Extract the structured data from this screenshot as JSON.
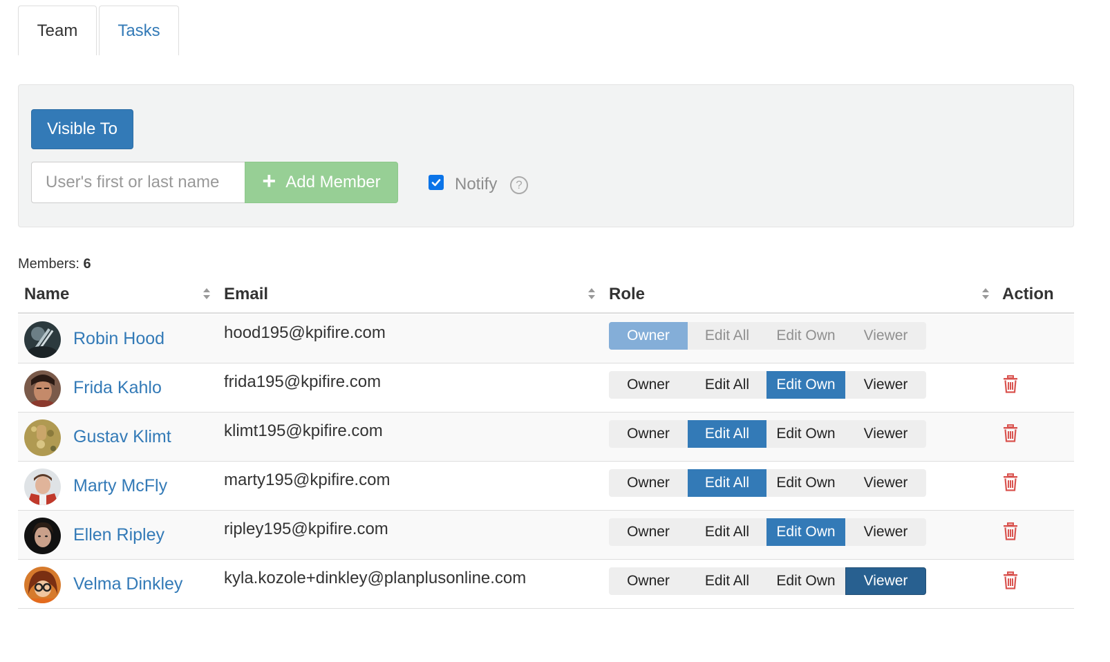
{
  "tabs": [
    {
      "label": "Team",
      "active": true
    },
    {
      "label": "Tasks",
      "active": false
    }
  ],
  "panel": {
    "visible_to_label": "Visible To",
    "search_placeholder": "User's first or last name",
    "add_member_label": "Add Member",
    "add_icon": "plus-icon",
    "notify_label": "Notify",
    "notify_checked": true,
    "help_icon": "question-circle-icon"
  },
  "members": {
    "label": "Members:",
    "count": "6"
  },
  "table": {
    "headers": {
      "name": "Name",
      "email": "Email",
      "role": "Role",
      "action": "Action"
    },
    "role_options": [
      "Owner",
      "Edit All",
      "Edit Own",
      "Viewer"
    ],
    "rows": [
      {
        "name": "Robin Hood",
        "email": "hood195@kpifire.com",
        "role": "Owner",
        "deletable": false
      },
      {
        "name": "Frida Kahlo",
        "email": "frida195@kpifire.com",
        "role": "Edit Own",
        "deletable": true
      },
      {
        "name": "Gustav Klimt",
        "email": "klimt195@kpifire.com",
        "role": "Edit All",
        "deletable": true
      },
      {
        "name": "Marty McFly",
        "email": "marty195@kpifire.com",
        "role": "Edit All",
        "deletable": true
      },
      {
        "name": "Ellen Ripley",
        "email": "ripley195@kpifire.com",
        "role": "Edit Own",
        "deletable": true
      },
      {
        "name": "Velma Dinkley",
        "email": "kyla.kozole+dinkley@planplusonline.com",
        "role": "Viewer",
        "deletable": true
      }
    ]
  },
  "colors": {
    "primary": "#337ab7",
    "primary_dark": "#286090",
    "success_light": "#97cf95",
    "danger": "#d9534f",
    "link": "#337ab7"
  }
}
